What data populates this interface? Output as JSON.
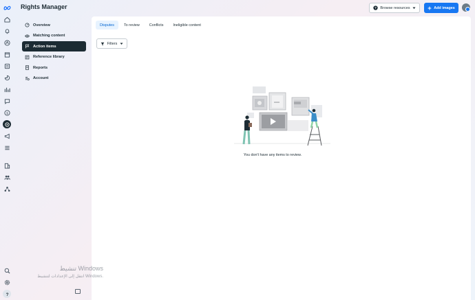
{
  "app": {
    "title": "Rights Manager"
  },
  "header": {
    "browse_label": "Browse resources",
    "add_label": "Add images"
  },
  "rail_icons": [
    "meta-logo-icon",
    "home-icon",
    "bell-icon",
    "profile-icon",
    "calendar-icon",
    "pages-icon",
    "insights-icon",
    "chart-icon",
    "chat-icon",
    "dollar-icon",
    "rights-manager-icon",
    "megaphone-icon",
    "menu-icon",
    "building-icon",
    "people-icon",
    "network-icon"
  ],
  "rail_bottom": [
    "search-icon",
    "gear-icon",
    "help-icon"
  ],
  "nav": {
    "items": [
      {
        "label": "Overview",
        "icon": "overview-icon"
      },
      {
        "label": "Matching content",
        "icon": "eye-icon"
      },
      {
        "label": "Action items",
        "icon": "flag-icon"
      },
      {
        "label": "Reference library",
        "icon": "library-icon"
      },
      {
        "label": "Reports",
        "icon": "report-icon"
      },
      {
        "label": "Account",
        "icon": "account-icon"
      }
    ],
    "active_index": 2
  },
  "tabs": [
    {
      "label": "Disputes"
    },
    {
      "label": "To review"
    },
    {
      "label": "Conflicts"
    },
    {
      "label": "Ineligible content"
    }
  ],
  "active_tab": 0,
  "filters_label": "Filters",
  "empty_message": "You don't have any items to review.",
  "watermark": {
    "line1": "تنشيط Windows",
    "line2": "انتقل إلى الإعدادات لتنشيط Windows."
  },
  "colors": {
    "accent": "#1877f2",
    "active_nav": "#1c2b33",
    "tab_active_bg": "#e7f3ff"
  }
}
